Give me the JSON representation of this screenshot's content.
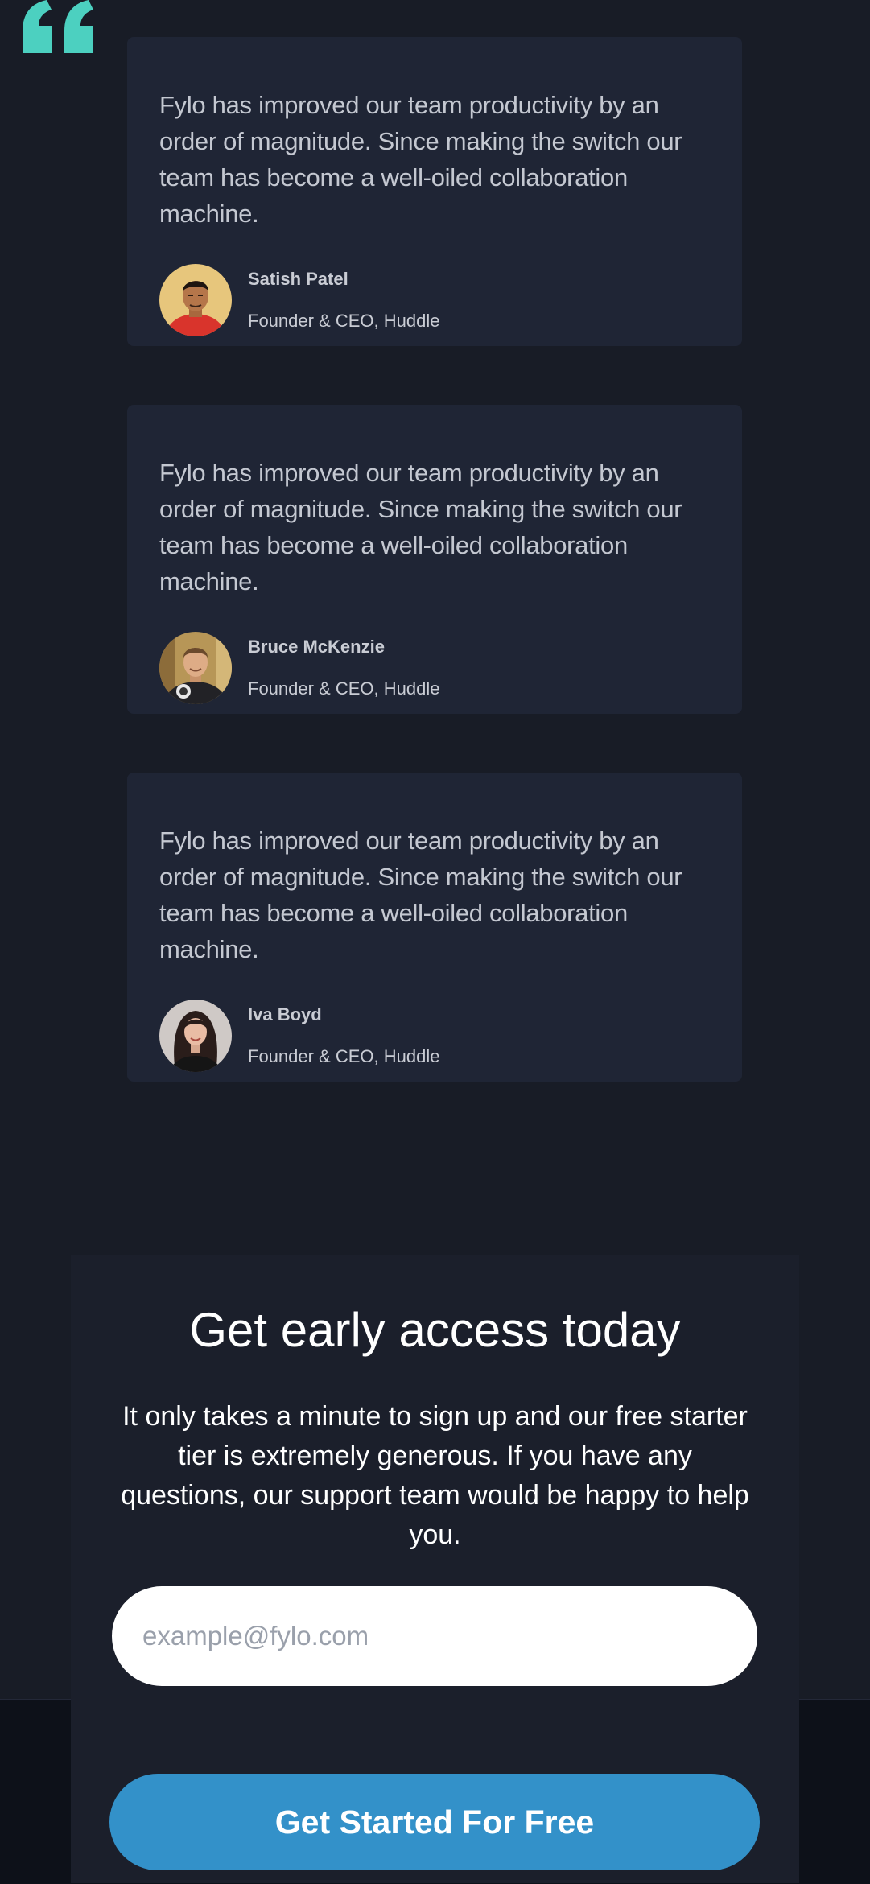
{
  "testimonials": [
    {
      "text": "Fylo has improved our team productivity by an order of magnitude. Since making the switch our team has become a well-oiled collaboration machine.",
      "name": "Satish Patel",
      "role": "Founder & CEO, Huddle"
    },
    {
      "text": "Fylo has improved our team productivity by an order of magnitude. Since making the switch our team has become a well-oiled collaboration machine.",
      "name": "Bruce McKenzie",
      "role": "Founder & CEO, Huddle"
    },
    {
      "text": "Fylo has improved our team productivity by an order of magnitude. Since making the switch our team has become a well-oiled collaboration machine.",
      "name": "Iva Boyd",
      "role": "Founder & CEO, Huddle"
    }
  ],
  "cta": {
    "title": "Get early access today",
    "description": "It only takes a minute to sign up and our free starter tier is extremely generous. If you have any questions, our support team would be happy to help you.",
    "email_placeholder": "example@fylo.com",
    "button_label": "Get Started For Free"
  },
  "icons": {
    "quote": "quote-icon",
    "avatar": "avatar"
  },
  "colors": {
    "background": "#181c26",
    "card": "#1f2535",
    "accent_quote": "#4cd0c0",
    "button": "#3391c9",
    "footer": "#0d1119"
  }
}
